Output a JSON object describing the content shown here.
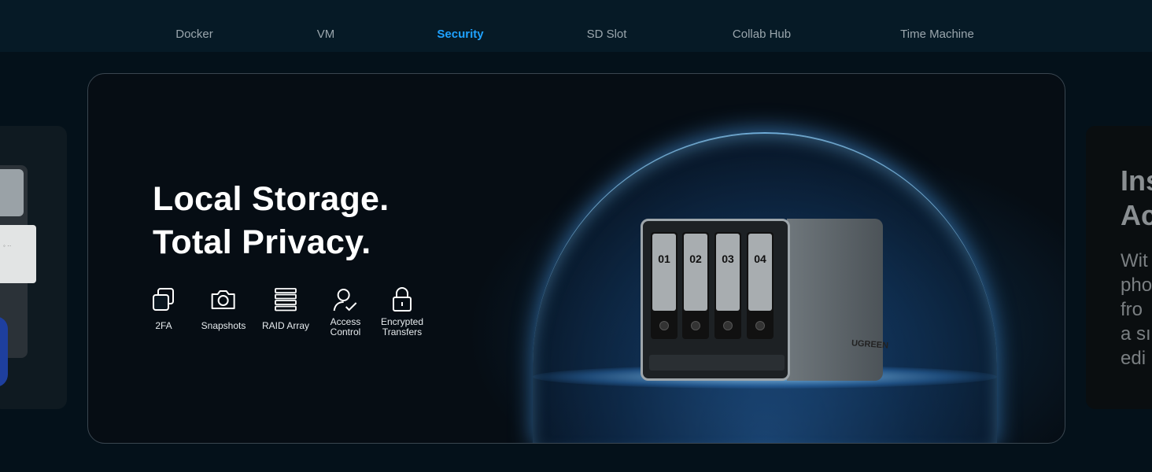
{
  "nav": {
    "tabs": [
      {
        "label": "Docker"
      },
      {
        "label": "VM"
      },
      {
        "label": "Security",
        "active": true
      },
      {
        "label": "SD Slot"
      },
      {
        "label": "Collab Hub"
      },
      {
        "label": "Time Machine"
      }
    ]
  },
  "hero": {
    "headline_line1": "Local Storage.",
    "headline_line2": "Total Privacy.",
    "features": [
      {
        "label_line1": "2FA",
        "label_line2": "",
        "icon": "two-squares-icon"
      },
      {
        "label_line1": "Snapshots",
        "label_line2": "",
        "icon": "camera-icon"
      },
      {
        "label_line1": "RAID Array",
        "label_line2": "",
        "icon": "stacked-drives-icon"
      },
      {
        "label_line1": "Access",
        "label_line2": "Control",
        "icon": "user-check-icon"
      },
      {
        "label_line1": "Encrypted",
        "label_line2": "Transfers",
        "icon": "lock-icon"
      }
    ],
    "device": {
      "bays": [
        "01",
        "02",
        "03",
        "04"
      ],
      "brand": "UGREEN"
    }
  },
  "right_peek": {
    "heading_line1": "Ins",
    "heading_line2": "Ac",
    "body_lines": [
      "Wit",
      "pho",
      "fro",
      "a sı",
      "edi"
    ]
  },
  "colors": {
    "active_tab": "#1fa2ff",
    "background": "#04111a",
    "dome_glow": "#50aaff"
  }
}
